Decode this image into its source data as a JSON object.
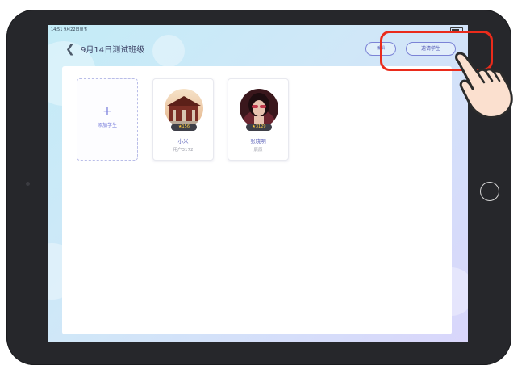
{
  "status_bar": {
    "time_date": "14:51  9月22日周五"
  },
  "header": {
    "title": "9月14日测试班级",
    "edit_label": "编辑",
    "invite_label": "邀请学生"
  },
  "add_student": {
    "icon": "plus-icon",
    "label": "添加学生"
  },
  "students": [
    {
      "name": "小米",
      "sub": "用户3172",
      "stars": "156",
      "avatar_colors": [
        "#f2d3b0",
        "#8a3a2c"
      ]
    },
    {
      "name": "张晓明",
      "sub": "辰辰",
      "stars": "3129",
      "avatar_colors": [
        "#3c1a1f",
        "#c85a6a"
      ]
    }
  ],
  "overlay": {
    "highlight_color": "#ea2b1b",
    "pointer_icon": "hand-pointer-icon"
  }
}
